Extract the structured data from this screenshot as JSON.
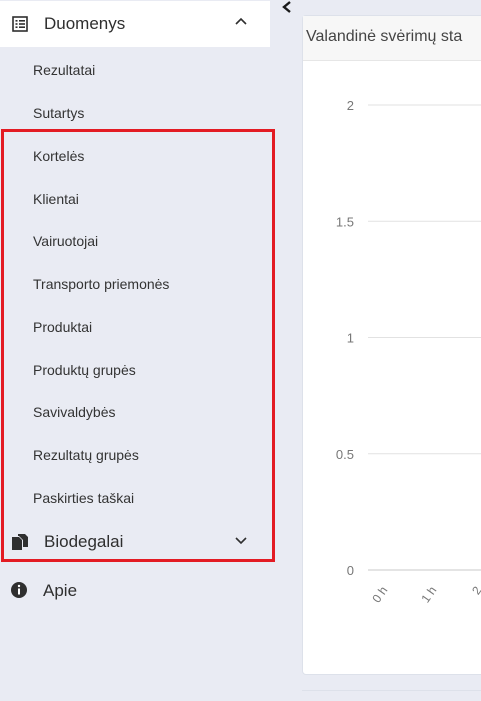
{
  "sidebar": {
    "sections": [
      {
        "label": "Duomenys",
        "icon": "list-icon",
        "expanded": true
      },
      {
        "label": "Biodegalai",
        "icon": "copy-icon",
        "expanded": false
      }
    ],
    "items": [
      "Rezultatai",
      "Sutartys",
      "Kortelės",
      "Klientai",
      "Vairuotojai",
      "Transporto priemonės",
      "Produktai",
      "Produktų grupės",
      "Savivaldybės",
      "Rezultatų grupės",
      "Paskirties taškai"
    ],
    "about": {
      "label": "Apie",
      "icon": "info-icon"
    }
  },
  "card": {
    "title": "Valandinė svėrimų sta"
  },
  "chart_data": {
    "type": "line",
    "title": "Valandinė svėrimų sta",
    "ylim": [
      0,
      2
    ],
    "yticks": [
      "0",
      "0.5",
      "1",
      "1.5",
      "2"
    ],
    "xticks": [
      "0 h",
      "1 h",
      "2"
    ],
    "grid": true
  },
  "colors": {
    "highlight": "#e31b23",
    "sidebar_bg": "#e9ebf3",
    "active_bg": "#ffffff"
  }
}
